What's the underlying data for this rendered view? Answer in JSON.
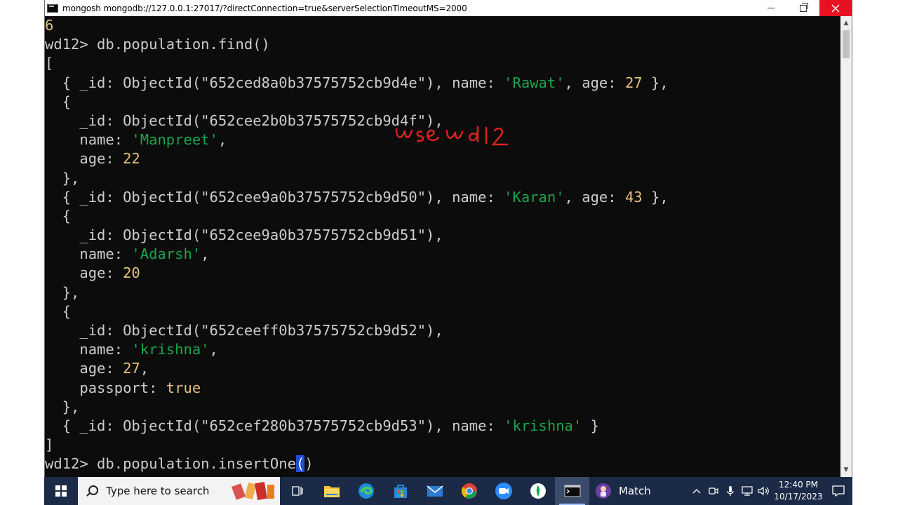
{
  "window": {
    "title": "mongosh mongodb://127.0.0.1:27017/?directConnection=true&serverSelectionTimeoutMS=2000",
    "controls": {
      "minimize": "minimize",
      "restore": "restore",
      "close": "close"
    }
  },
  "terminal": {
    "lines": [
      [
        {
          "t": "num",
          "v": "6"
        }
      ],
      [
        {
          "t": "plain",
          "v": "wd12> db.population.find()"
        }
      ],
      [
        {
          "t": "plain",
          "v": "["
        }
      ],
      [
        {
          "t": "plain",
          "v": "  { _id: ObjectId(\"652ced8a0b37575752cb9d4e\"), name: "
        },
        {
          "t": "str",
          "v": "'Rawat'"
        },
        {
          "t": "plain",
          "v": ", age: "
        },
        {
          "t": "num",
          "v": "27"
        },
        {
          "t": "plain",
          "v": " },"
        }
      ],
      [
        {
          "t": "plain",
          "v": "  {"
        }
      ],
      [
        {
          "t": "plain",
          "v": "    _id: ObjectId(\"652cee2b0b37575752cb9d4f\"),"
        }
      ],
      [
        {
          "t": "plain",
          "v": "    name: "
        },
        {
          "t": "str",
          "v": "'Manpreet'"
        },
        {
          "t": "plain",
          "v": ","
        }
      ],
      [
        {
          "t": "plain",
          "v": "    age: "
        },
        {
          "t": "num",
          "v": "22"
        }
      ],
      [
        {
          "t": "plain",
          "v": "  },"
        }
      ],
      [
        {
          "t": "plain",
          "v": "  { _id: ObjectId(\"652cee9a0b37575752cb9d50\"), name: "
        },
        {
          "t": "str",
          "v": "'Karan'"
        },
        {
          "t": "plain",
          "v": ", age: "
        },
        {
          "t": "num",
          "v": "43"
        },
        {
          "t": "plain",
          "v": " },"
        }
      ],
      [
        {
          "t": "plain",
          "v": "  {"
        }
      ],
      [
        {
          "t": "plain",
          "v": "    _id: ObjectId(\"652cee9a0b37575752cb9d51\"),"
        }
      ],
      [
        {
          "t": "plain",
          "v": "    name: "
        },
        {
          "t": "str",
          "v": "'Adarsh'"
        },
        {
          "t": "plain",
          "v": ","
        }
      ],
      [
        {
          "t": "plain",
          "v": "    age: "
        },
        {
          "t": "num",
          "v": "20"
        }
      ],
      [
        {
          "t": "plain",
          "v": "  },"
        }
      ],
      [
        {
          "t": "plain",
          "v": "  {"
        }
      ],
      [
        {
          "t": "plain",
          "v": "    _id: ObjectId(\"652ceeff0b37575752cb9d52\"),"
        }
      ],
      [
        {
          "t": "plain",
          "v": "    name: "
        },
        {
          "t": "str",
          "v": "'krishna'"
        },
        {
          "t": "plain",
          "v": ","
        }
      ],
      [
        {
          "t": "plain",
          "v": "    age: "
        },
        {
          "t": "num",
          "v": "27"
        },
        {
          "t": "plain",
          "v": ","
        }
      ],
      [
        {
          "t": "plain",
          "v": "    passport: "
        },
        {
          "t": "num",
          "v": "true"
        }
      ],
      [
        {
          "t": "plain",
          "v": "  },"
        }
      ],
      [
        {
          "t": "plain",
          "v": "  { _id: ObjectId(\"652cef280b37575752cb9d53\"), name: "
        },
        {
          "t": "str",
          "v": "'krishna'"
        },
        {
          "t": "plain",
          "v": " }"
        }
      ],
      [
        {
          "t": "plain",
          "v": "]"
        }
      ],
      [
        {
          "t": "plain",
          "v": "wd12> db.population.insertOne"
        },
        {
          "t": "cursor",
          "v": "("
        },
        {
          "t": "plain",
          "v": ")"
        }
      ]
    ],
    "annotation": "use wd12",
    "annotation_color": "#e02020"
  },
  "colors": {
    "terminal_bg": "#0c0c0c",
    "text": "#cccccc",
    "number": "#e5c07b",
    "string": "#19a64b",
    "close_button": "#e81123",
    "taskbar": "#1b2a47"
  },
  "taskbar": {
    "search_placeholder": "Type here to search",
    "apps": [
      "task-view-icon",
      "file-explorer-icon",
      "edge-icon",
      "store-icon",
      "mail-icon",
      "chrome-icon",
      "zoom-icon",
      "mongodb-compass-icon",
      "terminal-icon"
    ],
    "match_label": "Match",
    "clock_time": "12:40 PM",
    "clock_date": "10/17/2023"
  }
}
